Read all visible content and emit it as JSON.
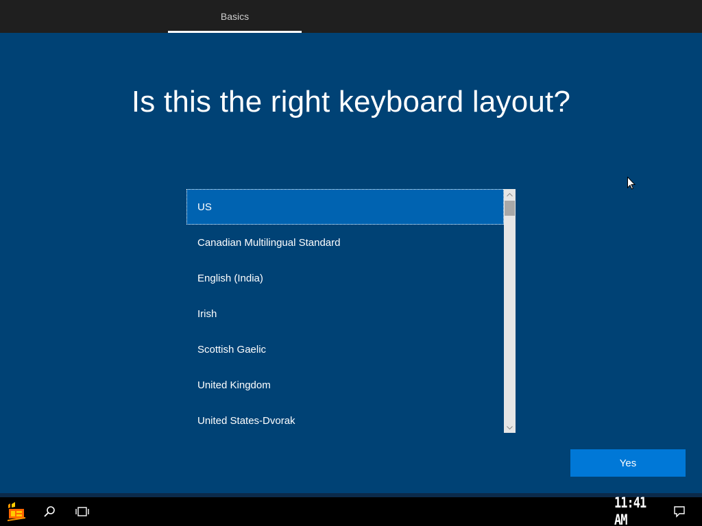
{
  "header": {
    "tab_label": "Basics"
  },
  "main": {
    "heading": "Is this the right keyboard layout?",
    "layouts": [
      "US",
      "Canadian Multilingual Standard",
      "English (India)",
      "Irish",
      "Scottish Gaelic",
      "United Kingdom",
      "United States-Dvorak"
    ],
    "selected_layout": "US",
    "yes_label": "Yes"
  },
  "taskbar": {
    "start_icon": "start-logo-icon",
    "search_icon": "search-icon",
    "task_view_icon": "task-view-icon",
    "clock": "11:41 AM",
    "notification_icon": "action-center-icon"
  },
  "colors": {
    "background": "#004275",
    "top_bar": "#1f1f1f",
    "selected_item": "#0063b1",
    "accent_button": "#0078d7",
    "taskbar": "#000000"
  }
}
